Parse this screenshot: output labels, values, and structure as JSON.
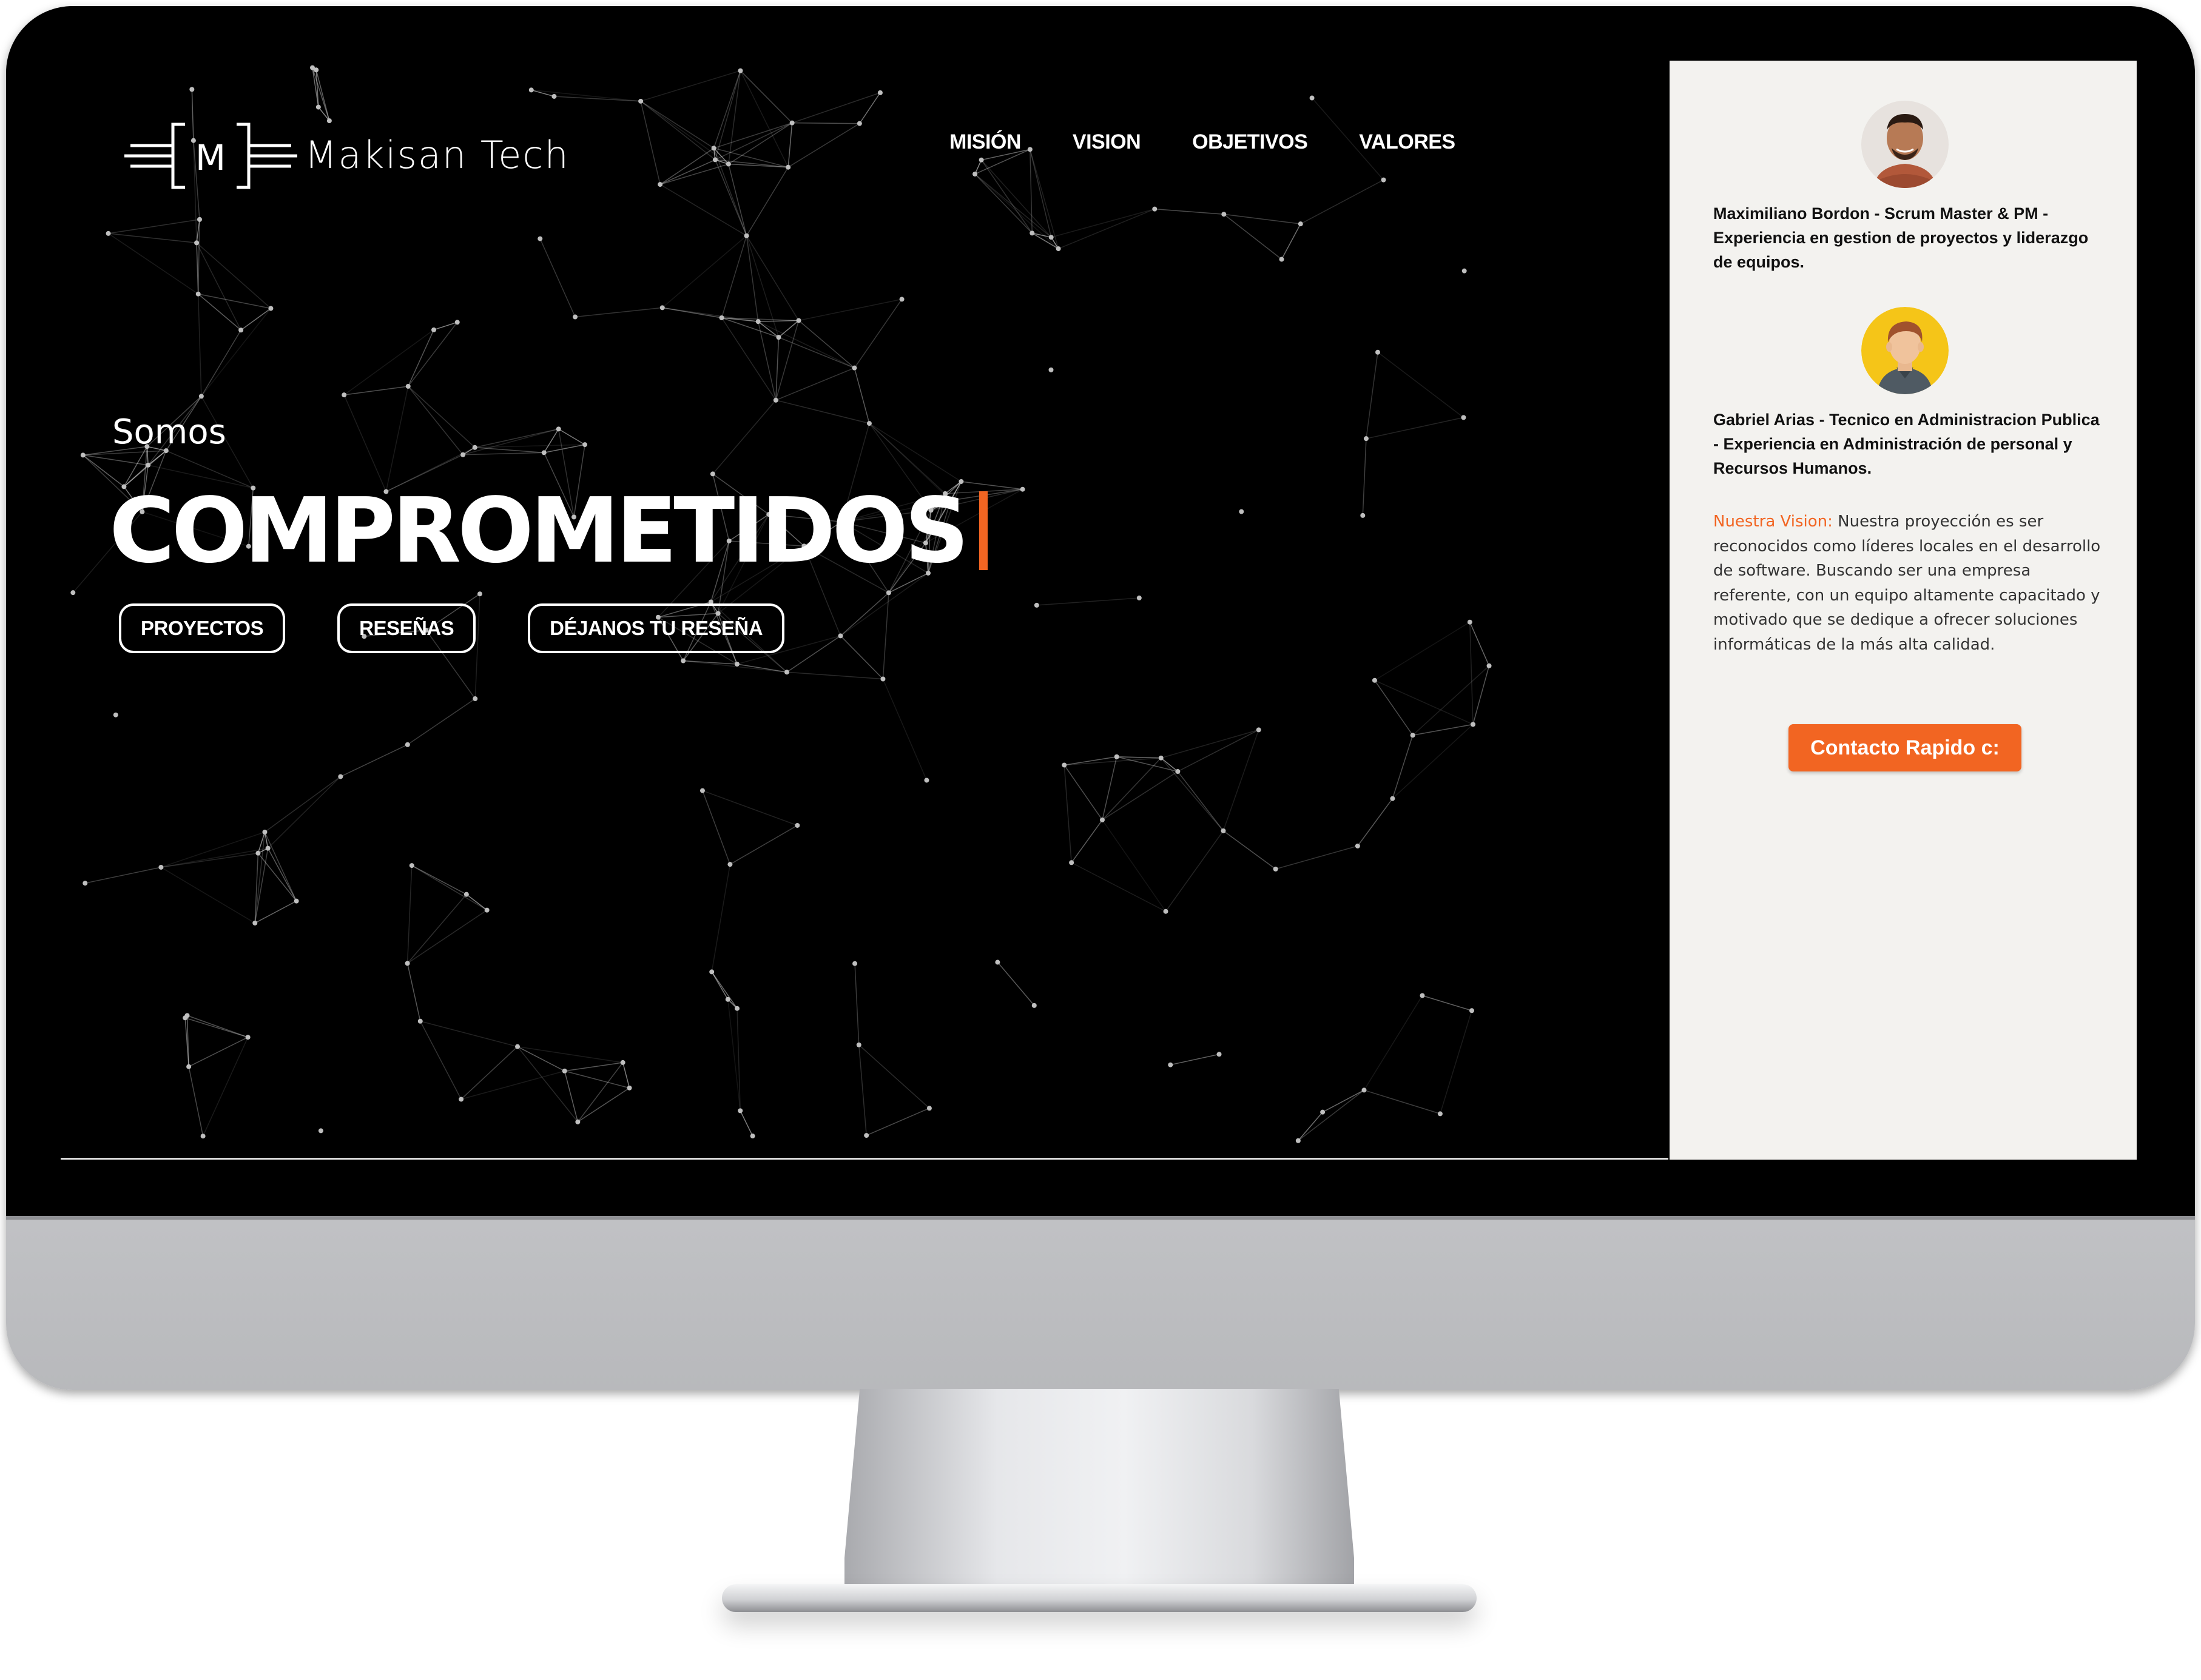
{
  "brand": {
    "logo_letter": "M",
    "name": "Makisan Tech"
  },
  "nav": {
    "items": [
      "MISIÓN",
      "VISION",
      "OBJETIVOS",
      "VALORES"
    ]
  },
  "hero": {
    "intro": "Somos",
    "headline": "COMPROMETIDOS",
    "buttons": [
      "PROYECTOS",
      "RESEÑAS",
      "DÉJANOS TU RESEÑA"
    ]
  },
  "team": {
    "members": [
      {
        "text": "Maximiliano Bordon - Scrum Master & PM - Experiencia en gestion de proyectos y liderazgo de equipos.",
        "avatar_icon": "avatar-photo-icon"
      },
      {
        "text": "Gabriel Arias - Tecnico en Administracion Publica - Experiencia en Administración de personal y Recursos Humanos.",
        "avatar_icon": "avatar-illustration-icon"
      }
    ]
  },
  "vision": {
    "label": "Nuestra Vision:",
    "text": " Nuestra proyección es ser reconocidos como líderes locales en el desarrollo de software. Buscando ser una empresa referente, con un equipo altamente capacitado y motivado que se dedique a ofrecer soluciones informáticas de la más alta calidad."
  },
  "contact": {
    "label": "Contacto Rapido c:"
  },
  "colors": {
    "accent": "#f26522",
    "panel_bg": "#f3f2ef",
    "screen_bg": "#000000"
  }
}
